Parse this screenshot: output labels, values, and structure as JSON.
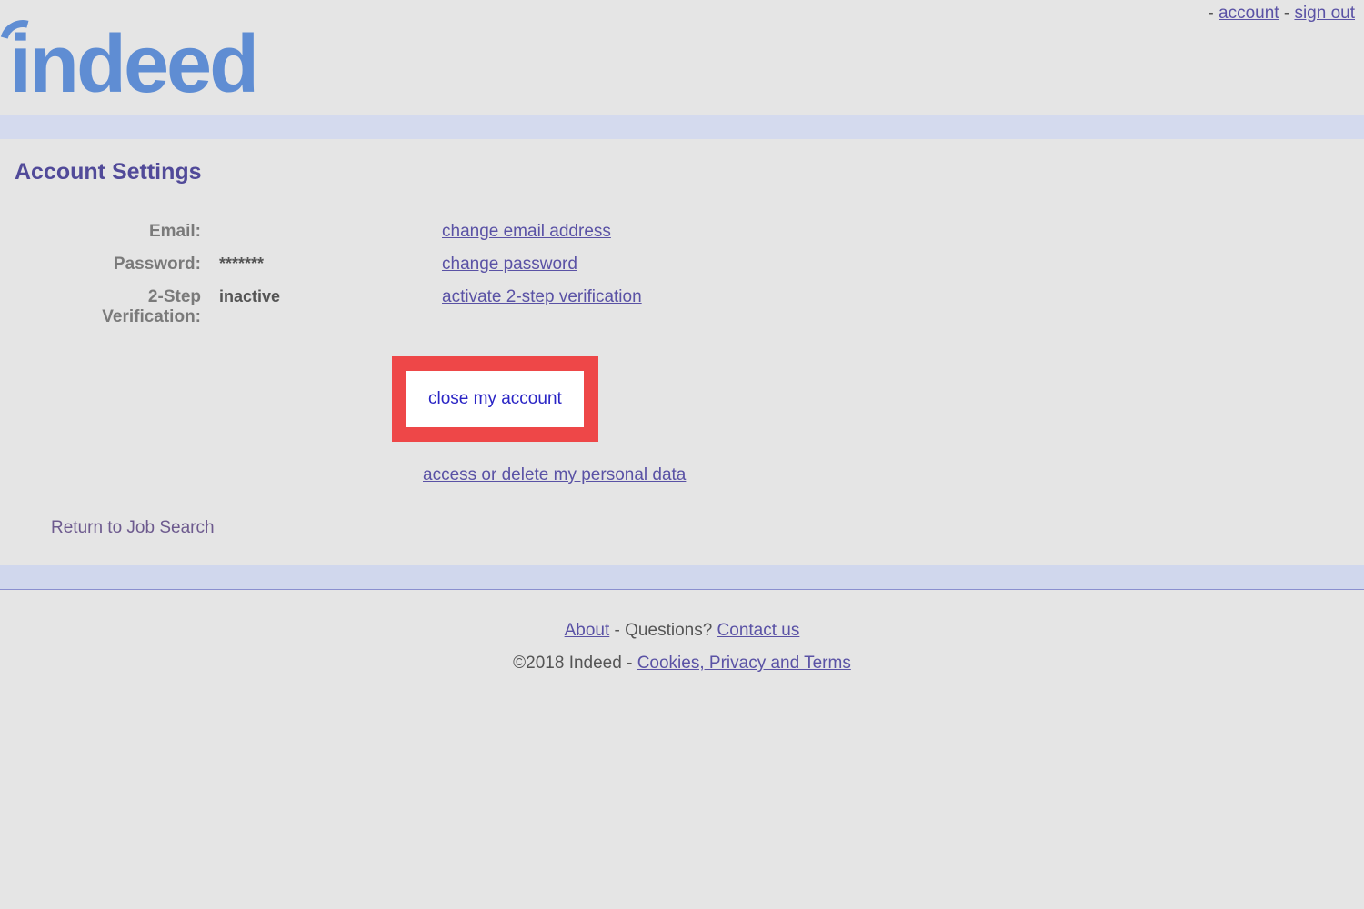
{
  "topLinks": {
    "separator1": "- ",
    "account": "account",
    "separator2": " - ",
    "signout": "sign out"
  },
  "logo": "indeed",
  "pageTitle": "Account Settings",
  "rows": {
    "email": {
      "label": "Email:",
      "value": "",
      "action": "change email address"
    },
    "password": {
      "label": "Password:",
      "value": "*******",
      "action": "change password"
    },
    "twoStep": {
      "label": "2-Step Verification:",
      "value": "inactive",
      "action": "activate 2-step verification"
    }
  },
  "closeAccount": "close my account",
  "personalData": "access or delete my personal data",
  "returnLink": "Return to Job Search",
  "footer": {
    "about": "About",
    "questions": " - Questions? ",
    "contact": "Contact us",
    "copyright": "©2018 Indeed - ",
    "cookies": "Cookies, Privacy and Terms"
  }
}
